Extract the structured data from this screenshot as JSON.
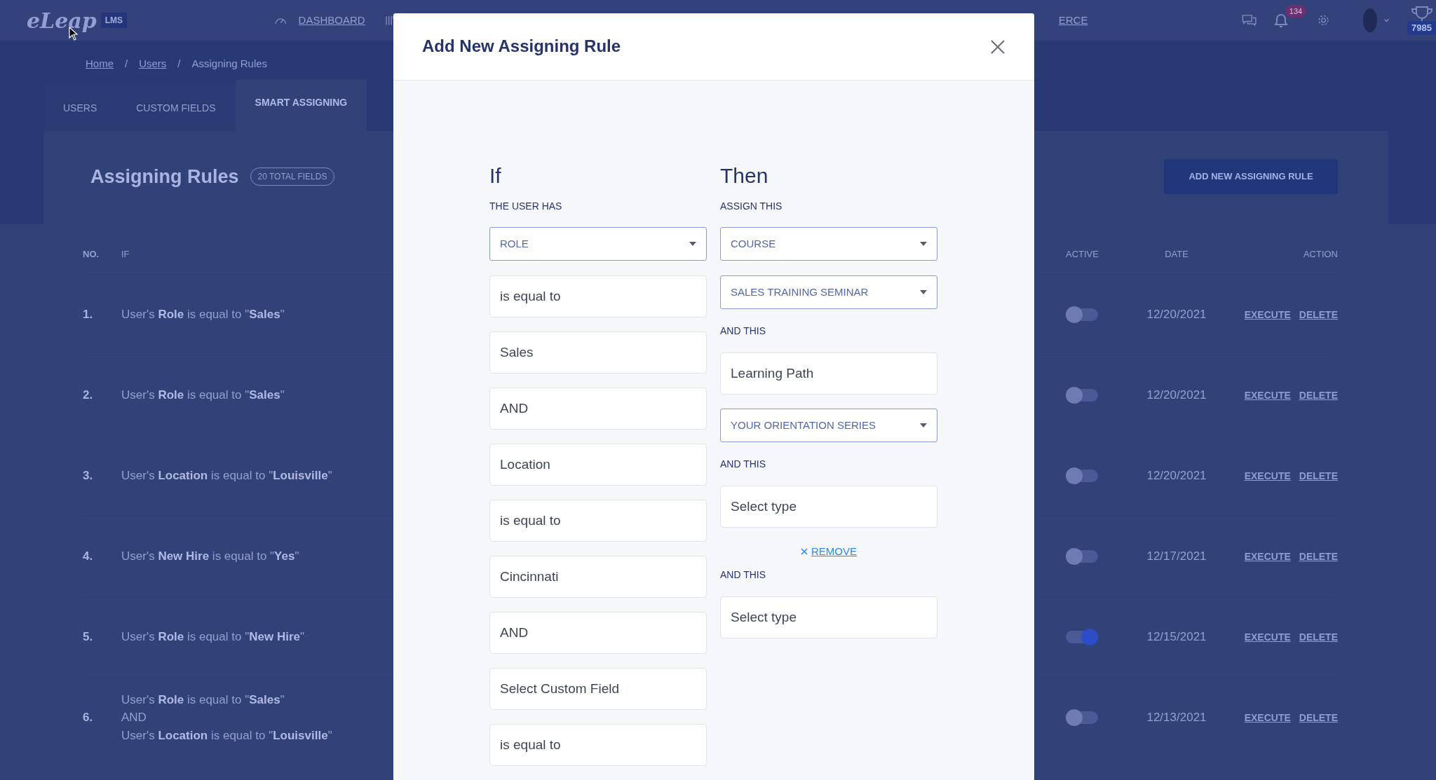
{
  "navbar": {
    "logo": "eLeap",
    "logo_badge": "LMS",
    "items": [
      {
        "label": "DASHBOARD"
      },
      {
        "label": "ERCE"
      }
    ],
    "notification_count": "134",
    "points": "7985"
  },
  "breadcrumb": {
    "separator": "/",
    "items": [
      {
        "label": "Home",
        "link": true
      },
      {
        "label": "Users",
        "link": true
      },
      {
        "label": "Assigning Rules",
        "link": false
      }
    ]
  },
  "tabs": [
    {
      "label": "USERS",
      "selected": false
    },
    {
      "label": "CUSTOM FIELDS",
      "selected": false
    },
    {
      "label": "SMART ASSIGNING",
      "selected": true
    }
  ],
  "page": {
    "title": "Assigning Rules",
    "count_badge": "20 TOTAL FIELDS",
    "add_button": "ADD NEW ASSIGNING RULE"
  },
  "table": {
    "columns": [
      "NO.",
      "IF",
      "ACTIVE",
      "DATE",
      "ACTION"
    ],
    "rows": [
      {
        "number": "1.",
        "condition": [
          "User's **Role** is equal to \"**Sales**\""
        ],
        "active": false,
        "date": "12/20/2021",
        "actions": [
          "EXECUTE",
          "DELETE"
        ]
      },
      {
        "number": "2.",
        "condition": [
          "User's **Role** is equal to \"**Sales**\""
        ],
        "active": false,
        "date": "12/20/2021",
        "actions": [
          "EXECUTE",
          "DELETE"
        ]
      },
      {
        "number": "3.",
        "condition": [
          "User's **Location** is equal to \"**Louisville**\""
        ],
        "active": false,
        "date": "12/20/2021",
        "actions": [
          "EXECUTE",
          "DELETE"
        ]
      },
      {
        "number": "4.",
        "condition": [
          "User's **New Hire** is equal to \"**Yes**\""
        ],
        "active": false,
        "date": "12/17/2021",
        "actions": [
          "EXECUTE",
          "DELETE"
        ]
      },
      {
        "number": "5.",
        "condition": [
          "User's **Role** is equal to \"**New Hire**\""
        ],
        "active": true,
        "date": "12/15/2021",
        "actions": [
          "EXECUTE",
          "DELETE"
        ]
      },
      {
        "number": "6.",
        "condition": [
          "User's **Role** is equal to \"**Sales**\"",
          "AND",
          "User's **Location** is equal to \"**Louisville**\""
        ],
        "active": false,
        "date": "12/13/2021",
        "actions": [
          "EXECUTE",
          "DELETE"
        ]
      }
    ]
  },
  "modal": {
    "title": "Add New Assigning Rule",
    "if_column": {
      "heading": "If",
      "subheading": "THE USER HAS",
      "fields": [
        {
          "kind": "select",
          "value": "ROLE"
        },
        {
          "kind": "input",
          "value": "is equal to"
        },
        {
          "kind": "input",
          "value": "Sales"
        },
        {
          "kind": "input",
          "value": "AND"
        },
        {
          "kind": "input",
          "value": "Location"
        },
        {
          "kind": "input",
          "value": "is equal to"
        },
        {
          "kind": "input",
          "value": "Cincinnati"
        },
        {
          "kind": "input",
          "value": "AND"
        },
        {
          "kind": "input",
          "value": "Select Custom Field"
        },
        {
          "kind": "input",
          "value": "is equal to"
        }
      ]
    },
    "then_column": {
      "heading": "Then",
      "subheading": "ASSIGN THIS",
      "items": [
        {
          "kind": "select",
          "value": "COURSE"
        },
        {
          "kind": "select",
          "value": "SALES TRAINING SEMINAR"
        },
        {
          "kind": "label",
          "text": "AND THIS"
        },
        {
          "kind": "input",
          "value": "Learning Path"
        },
        {
          "kind": "select",
          "value": "YOUR ORIENTATION SERIES"
        },
        {
          "kind": "label",
          "text": "AND THIS"
        },
        {
          "kind": "input",
          "value": "Select type"
        },
        {
          "kind": "remove",
          "text": "REMOVE"
        },
        {
          "kind": "label",
          "text": "AND THIS"
        },
        {
          "kind": "input",
          "value": "Select type"
        }
      ]
    }
  }
}
